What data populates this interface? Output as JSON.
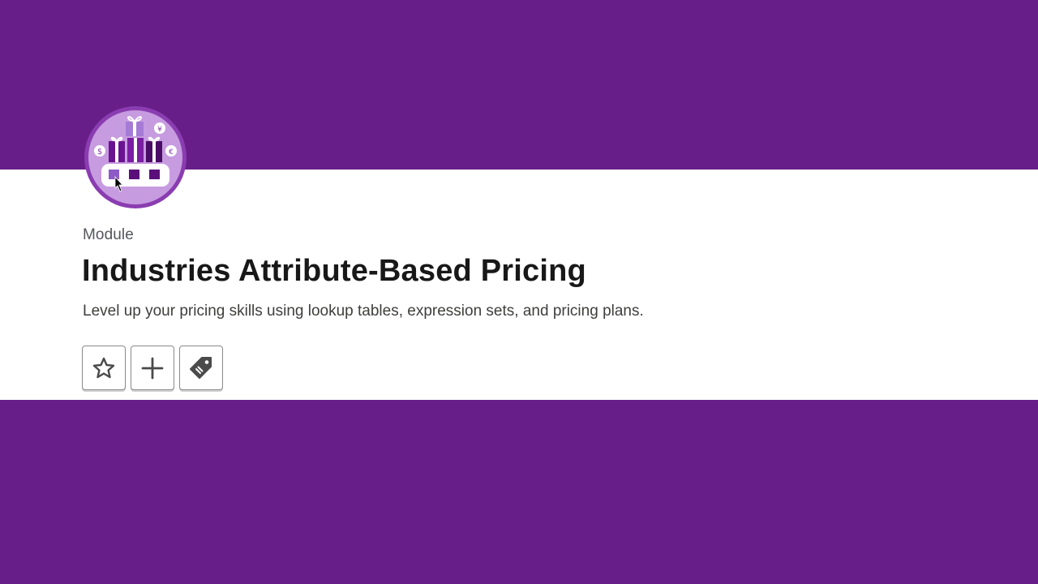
{
  "module": {
    "eyebrow": "Module",
    "title": "Industries Attribute-Based Pricing",
    "description": "Level up your pricing skills using lookup tables, expression sets, and pricing plans."
  },
  "badge": {
    "icon": "gift-boxes-pricing-badge-icon",
    "coin_labels": [
      "$",
      "¥",
      "€"
    ]
  },
  "actions": [
    {
      "icon": "star-icon",
      "name": "favorite"
    },
    {
      "icon": "plus-icon",
      "name": "add"
    },
    {
      "icon": "tag-icon",
      "name": "tag"
    }
  ],
  "colors": {
    "band": "#671e88",
    "badge_ring": "#8a3db0",
    "badge_fill": "#c79be0",
    "box_dark": "#5a0f7a",
    "box_light": "#8e5bc6"
  }
}
